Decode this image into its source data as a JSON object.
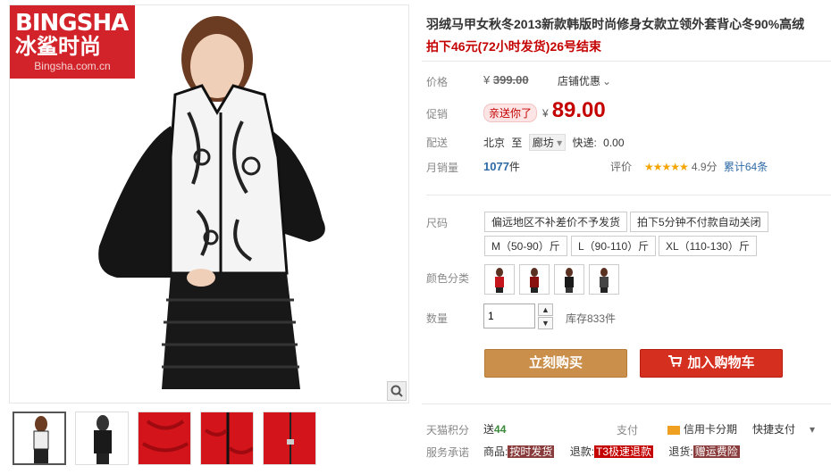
{
  "logo": {
    "line1": "BINGSHA",
    "line2": "冰鲨时尚",
    "line3": "Bingsha.com.cn"
  },
  "product": {
    "title": "羽绒马甲女秋冬2013新款韩版时尚修身女款立领外套背心冬90%高绒",
    "subtitle": "拍下46元(72小时发货)26号结束"
  },
  "price": {
    "label": "价格",
    "currency": "¥",
    "old": "399.00",
    "store_promo": "店铺优惠",
    "store_promo_arrow": "⌄"
  },
  "promo": {
    "label": "促销",
    "tag": "亲送你了",
    "currency": "¥",
    "current": "89.00"
  },
  "shipping": {
    "label": "配送",
    "from": "北京",
    "to_word": "至",
    "dest": "廊坊",
    "dest_arrow": "▾",
    "fee_label": "快递:",
    "fee": "0.00"
  },
  "sales": {
    "label": "月销量",
    "count": "1077",
    "unit": "件"
  },
  "rating": {
    "label": "评价",
    "stars": "★★★★★",
    "score": "4.9分",
    "reviews": "累计64条"
  },
  "size": {
    "label": "尺码",
    "notes": [
      "偏远地区不补差价不予发货",
      "拍下5分钟不付款自动关闭"
    ],
    "options": [
      "M（50-90）斤",
      "L（90-110）斤",
      "XL（110-130）斤"
    ]
  },
  "color": {
    "label": "颜色分类",
    "swatches": [
      "red",
      "red-black",
      "black",
      "black-grey"
    ]
  },
  "quantity": {
    "label": "数量",
    "value": "1",
    "stock": "库存833件",
    "up": "▲",
    "down": "▼"
  },
  "buttons": {
    "buy": "立刻购买",
    "cart": "加入购物车"
  },
  "bottom": {
    "points_label": "天猫积分",
    "points_prefix": "送",
    "points": "44",
    "pay_label": "支付",
    "credit": "信用卡分期",
    "quick_pay": "快捷支付",
    "promise_label": "服务承诺",
    "p1": "商品:",
    "p1_tag": "按时发货",
    "p2": "退款:",
    "p2_tag": "T3极速退款",
    "p3": "退货:",
    "p3_tag": "赠运费险"
  },
  "colors": {
    "accent": "#c40000",
    "buy": "#c98f4b",
    "cart": "#d5301f"
  }
}
